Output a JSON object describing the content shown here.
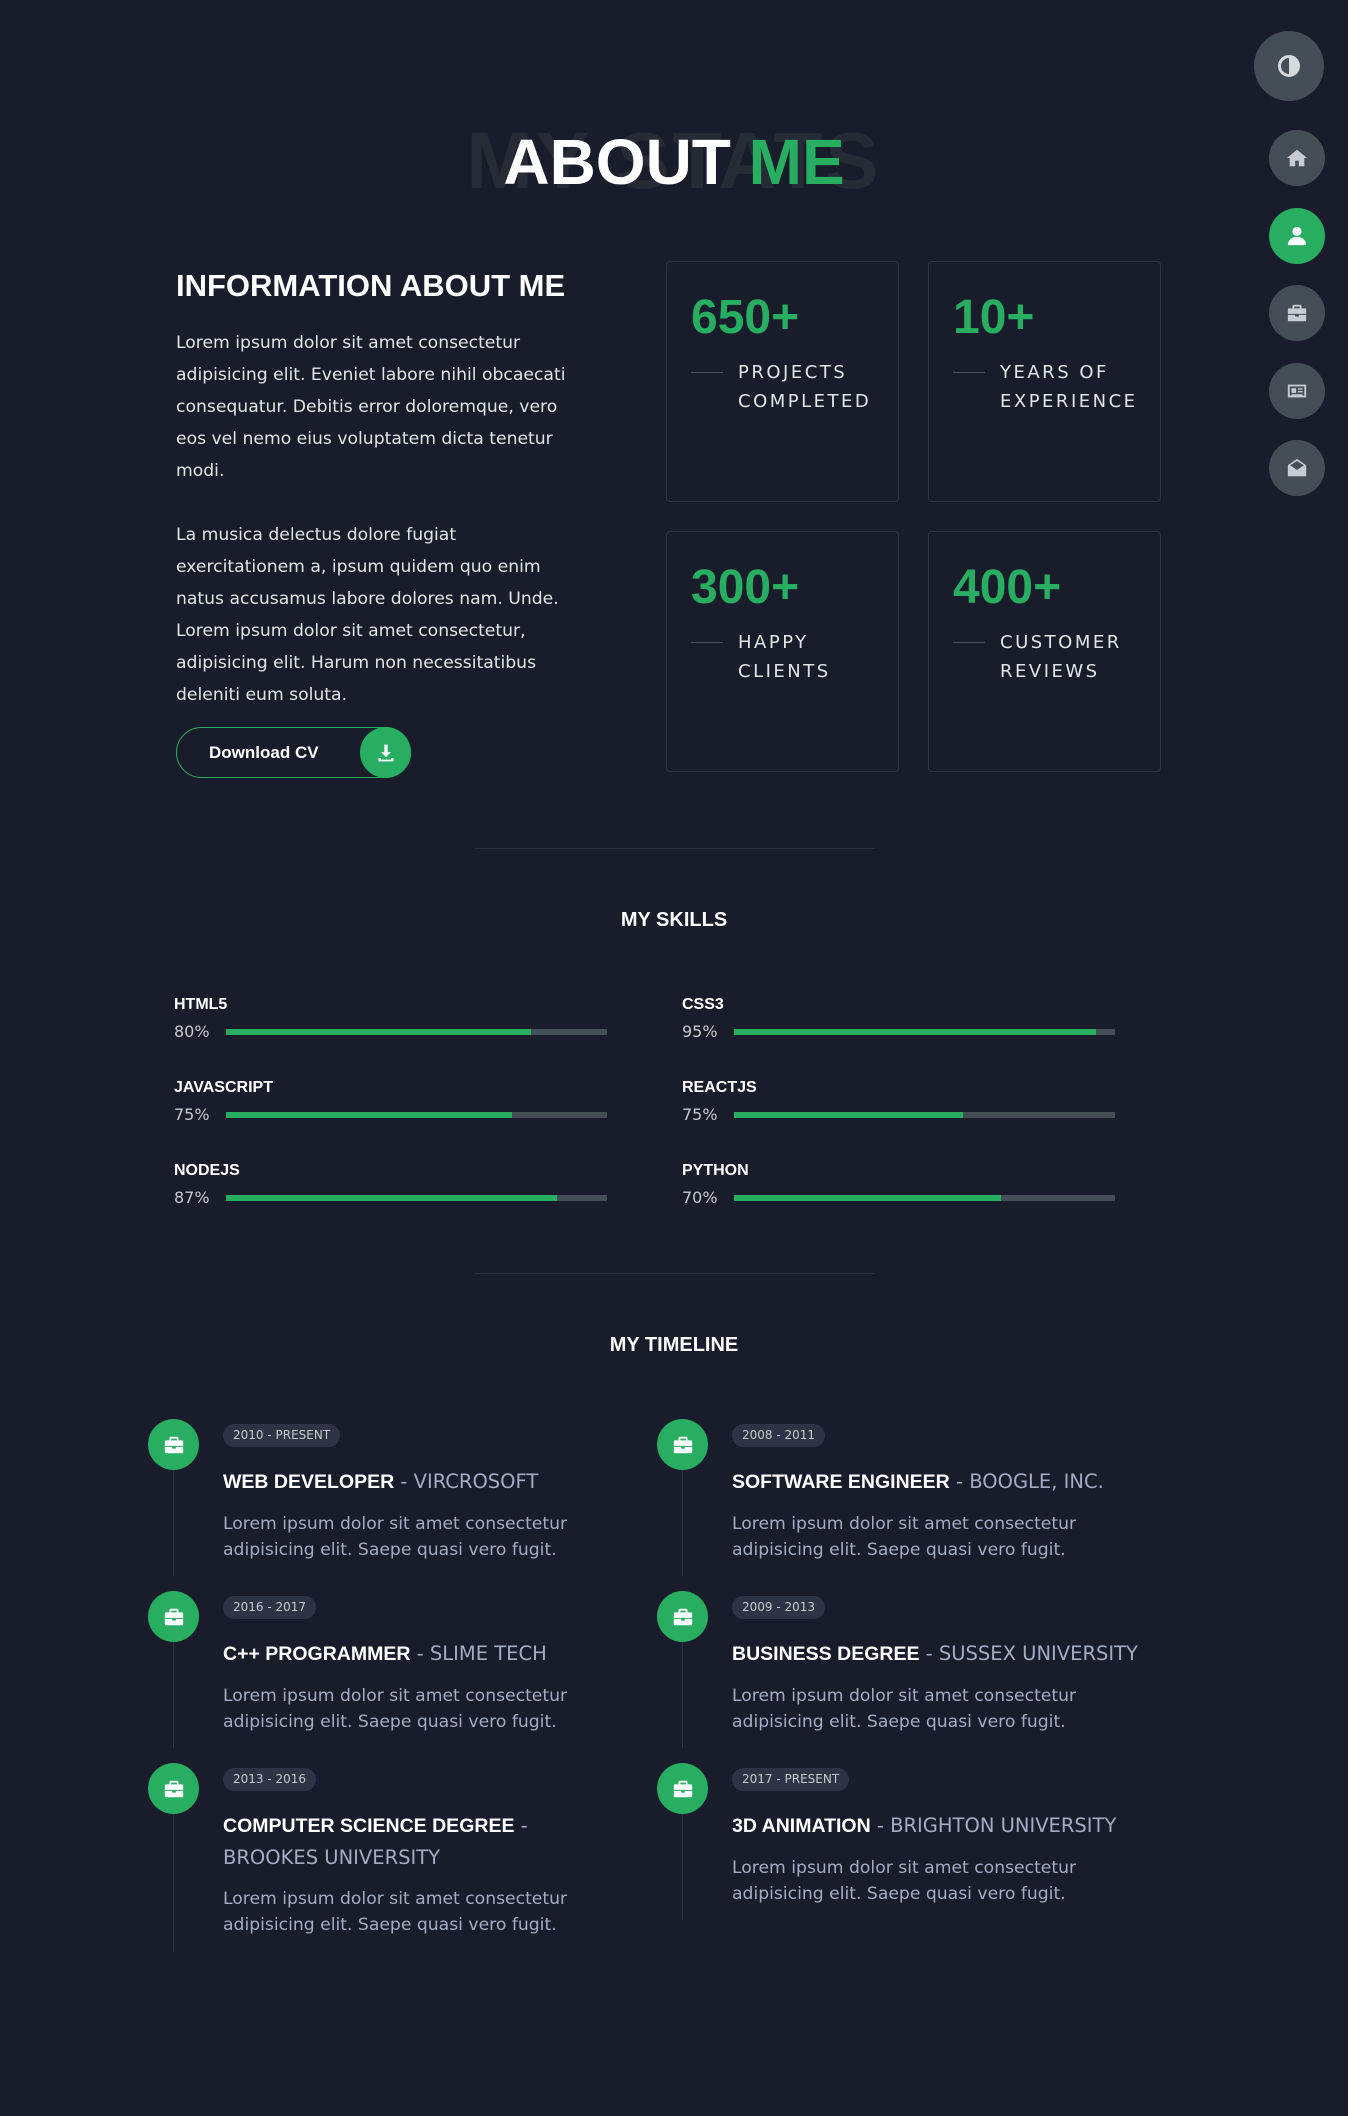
{
  "header": {
    "title_bg": "MY STATS",
    "title_main": "ABOUT ",
    "title_accent": "ME"
  },
  "about": {
    "heading": "INFORMATION ABOUT ME",
    "paragraph_1": "Lorem ipsum dolor sit amet consectetur adipisicing elit. Eveniet labore nihil obcaecati consequatur. Debitis error doloremque, vero eos vel nemo eius voluptatem dicta tenetur modi.",
    "paragraph_2": "La musica delectus dolore fugiat exercitationem a, ipsum quidem quo enim natus accusamus labore dolores nam. Unde. Lorem ipsum dolor sit amet consectetur, adipisicing elit. Harum non necessitatibus deleniti eum soluta.",
    "download_label": "Download CV"
  },
  "stats": [
    {
      "number": "650+",
      "label": "PROJECTS COMPLETED"
    },
    {
      "number": "10+",
      "label": "YEARS OF EXPERIENCE"
    },
    {
      "number": "300+",
      "label": "HAPPY CLIENTS"
    },
    {
      "number": "400+",
      "label": "CUSTOMER REVIEWS"
    }
  ],
  "skills_heading": "MY SKILLS",
  "skills": [
    {
      "name": "HTML5",
      "percent_label": "80%",
      "value": 0.8
    },
    {
      "name": "CSS3",
      "percent_label": "95%",
      "value": 0.95
    },
    {
      "name": "JAVASCRIPT",
      "percent_label": "75%",
      "value": 0.75
    },
    {
      "name": "REACTJS",
      "percent_label": "75%",
      "value": 0.6
    },
    {
      "name": "NODEJS",
      "percent_label": "87%",
      "value": 0.87
    },
    {
      "name": "PYTHON",
      "percent_label": "70%",
      "value": 0.7
    }
  ],
  "timeline_heading": "MY TIMELINE",
  "timeline": [
    {
      "date": "2010 - PRESENT",
      "role": "WEB DEVELOPER",
      "org": " - VIRCROSOFT",
      "desc": "Lorem ipsum dolor sit amet consectetur adipisicing elit. Saepe quasi vero fugit."
    },
    {
      "date": "2008 - 2011",
      "role": "SOFTWARE ENGINEER",
      "org": " - BOOGLE, INC.",
      "desc": "Lorem ipsum dolor sit amet consectetur adipisicing elit. Saepe quasi vero fugit."
    },
    {
      "date": "2016 - 2017",
      "role": "C++ PROGRAMMER",
      "org": " - SLIME TECH",
      "desc": "Lorem ipsum dolor sit amet consectetur adipisicing elit. Saepe quasi vero fugit."
    },
    {
      "date": "2009 - 2013",
      "role": "BUSINESS DEGREE",
      "org": " - SUSSEX UNIVERSITY",
      "desc": "Lorem ipsum dolor sit amet consectetur adipisicing elit. Saepe quasi vero fugit."
    },
    {
      "date": "2013 - 2016",
      "role": "COMPUTER SCIENCE DEGREE",
      "org": " - BROOKES UNIVERSITY",
      "desc": "Lorem ipsum dolor sit amet consectetur adipisicing elit. Saepe quasi vero fugit."
    },
    {
      "date": "2017 - PRESENT",
      "role": "3D ANIMATION",
      "org": " - BRIGHTON UNIVERSITY",
      "desc": "Lorem ipsum dolor sit amet consectetur adipisicing elit. Saepe quasi vero fugit."
    }
  ],
  "icons": {
    "theme_toggle": "contrast-icon",
    "nav": [
      "home-icon",
      "user-icon",
      "briefcase-icon",
      "newspaper-icon",
      "envelope-open-icon"
    ],
    "download": "download-icon",
    "timeline": "briefcase-icon"
  },
  "colors": {
    "background": "#191d2b",
    "accent": "#27ae60",
    "nav_button": "#454e56",
    "text_muted": "#a4acc4"
  }
}
